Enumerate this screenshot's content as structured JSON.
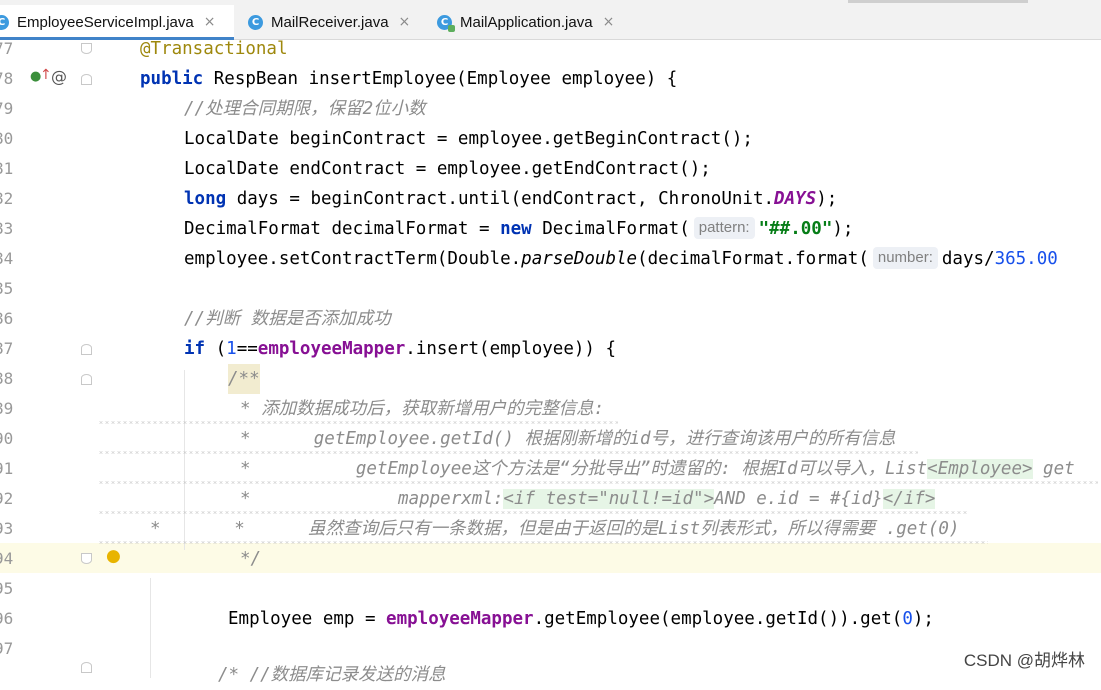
{
  "tabs": [
    {
      "name": "EmployeeServiceImpl.java",
      "icon": "c",
      "active": true
    },
    {
      "name": "MailReceiver.java",
      "icon": "c",
      "active": false
    },
    {
      "name": "MailApplication.java",
      "icon": "c",
      "active": false
    }
  ],
  "tab_close_glyph": "×",
  "line_numbers": [
    "77",
    "78",
    "79",
    "80",
    "81",
    "82",
    "83",
    "84",
    "85",
    "86",
    "87",
    "88",
    "89",
    "90",
    "91",
    "92",
    "93",
    "94",
    "95",
    "96",
    "97"
  ],
  "code": {
    "l77": {
      "anno": "@Transactional"
    },
    "l78": {
      "kw1": "public",
      "rest": " RespBean insertEmployee(Employee employee) {"
    },
    "l79": {
      "comment": "//处理合同期限，保留2位小数"
    },
    "l80": {
      "text": "LocalDate beginContract = employee.getBeginContract();"
    },
    "l81": {
      "text": "LocalDate endContract = employee.getEndContract();"
    },
    "l82": {
      "kw": "long",
      "mid": " days = beginContract.until(endContract, ChronoUnit.",
      "static": "DAYS",
      "end": ");"
    },
    "l83": {
      "pre": "DecimalFormat decimalFormat = ",
      "kw": "new",
      "mid": " DecimalFormat(",
      "hint": "pattern:",
      "str": "\"##.00\"",
      "end": ");"
    },
    "l84": {
      "pre": "employee.setContractTerm(Double.",
      "ital": "parseDouble",
      "mid": "(decimalFormat.format(",
      "hint": "number:",
      "post": "days/",
      "num": "365.00"
    },
    "l86": {
      "comment": "//判断 数据是否添加成功"
    },
    "l87": {
      "kw": "if",
      "p1": " (",
      "num": "1",
      "p2": "==",
      "field": "employeeMapper",
      "end": ".insert(employee)) {"
    },
    "l88": {
      "doc": "/**"
    },
    "l89": {
      "doc": "* 添加数据成功后，获取新增用户的完整信息:"
    },
    "l90": {
      "doc": "*      getEmployee.getId() 根据刚新增的id号，进行查询该用户的所有信息"
    },
    "l91": {
      "doc": "*          getEmployee这个方法是“分批导出”时遗留的: 根据Id可以导入，List",
      "tag": "<Employee>",
      "after": " get"
    },
    "l92": {
      "doc": "*              mapperxml:",
      "xml1": "<if test=\"null!=id\">",
      "mid": "AND e.id = #{id}",
      "xml2": "</if>"
    },
    "l93": {
      "doc": "*       *      虽然查询后只有一条数据，但是由于返回的是List列表形式，所以得需要 .get(0)"
    },
    "l94": {
      "doc": "*/"
    },
    "l96": {
      "pre": "Employee emp = ",
      "field": "employeeMapper",
      "mid": ".getEmployee(employee.getId()).get(",
      "num": "0",
      "end": ");"
    },
    "l97": {
      "doc": "/* //数据库记录发送的消息"
    }
  },
  "watermark": "CSDN @胡烨林",
  "colors": {
    "keyword": "#0033b3",
    "annotation": "#9e880d",
    "comment": "#8c8c8c",
    "field": "#871094",
    "number": "#1750eb",
    "string": "#067d17",
    "active_tab_underline": "#4083c9"
  }
}
